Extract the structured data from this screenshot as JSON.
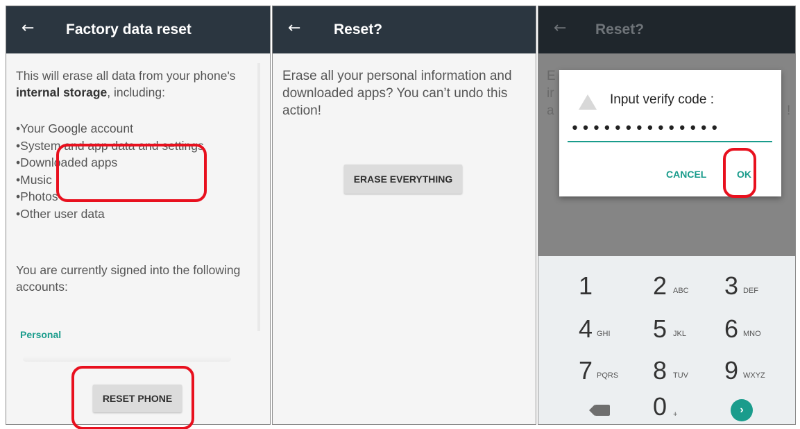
{
  "panel1": {
    "back_glyph": "←",
    "title": "Factory data reset",
    "intro_prefix": "This will erase all data from your phone's ",
    "intro_bold": "internal storage",
    "intro_suffix": ", including:",
    "bullets": [
      "Your Google account",
      "System and app data and settings",
      "Downloaded apps",
      "Music",
      "Photos",
      "Other user data"
    ],
    "signed_in_text": "You are currently signed into the following accounts:",
    "account_section": "Personal",
    "reset_button": "RESET PHONE"
  },
  "panel2": {
    "back_glyph": "←",
    "title": "Reset?",
    "message": "Erase all your personal information and downloaded apps? You can’t undo this action!",
    "erase_button": "ERASE EVERYTHING"
  },
  "panel3": {
    "back_glyph": "←",
    "title": "Reset?",
    "background_fragments": [
      "E",
      "ir",
      "a",
      "!"
    ],
    "dialog": {
      "title": "Input verify code :",
      "password_value": "••••••••••••••",
      "cancel": "CANCEL",
      "ok": "OK"
    },
    "keypad": {
      "keys": [
        {
          "digit": "1",
          "letters": ""
        },
        {
          "digit": "2",
          "letters": "ABC"
        },
        {
          "digit": "3",
          "letters": "DEF"
        },
        {
          "digit": "4",
          "letters": "GHI"
        },
        {
          "digit": "5",
          "letters": "JKL"
        },
        {
          "digit": "6",
          "letters": "MNO"
        },
        {
          "digit": "7",
          "letters": "PQRS"
        },
        {
          "digit": "8",
          "letters": "TUV"
        },
        {
          "digit": "9",
          "letters": "WXYZ"
        },
        {
          "digit": "0",
          "letters": "+"
        }
      ],
      "go_glyph": "›"
    }
  },
  "colors": {
    "appbar": "#2b3640",
    "accent": "#1a9c8c",
    "highlight": "#e8101e",
    "button": "#dcdcdc"
  }
}
